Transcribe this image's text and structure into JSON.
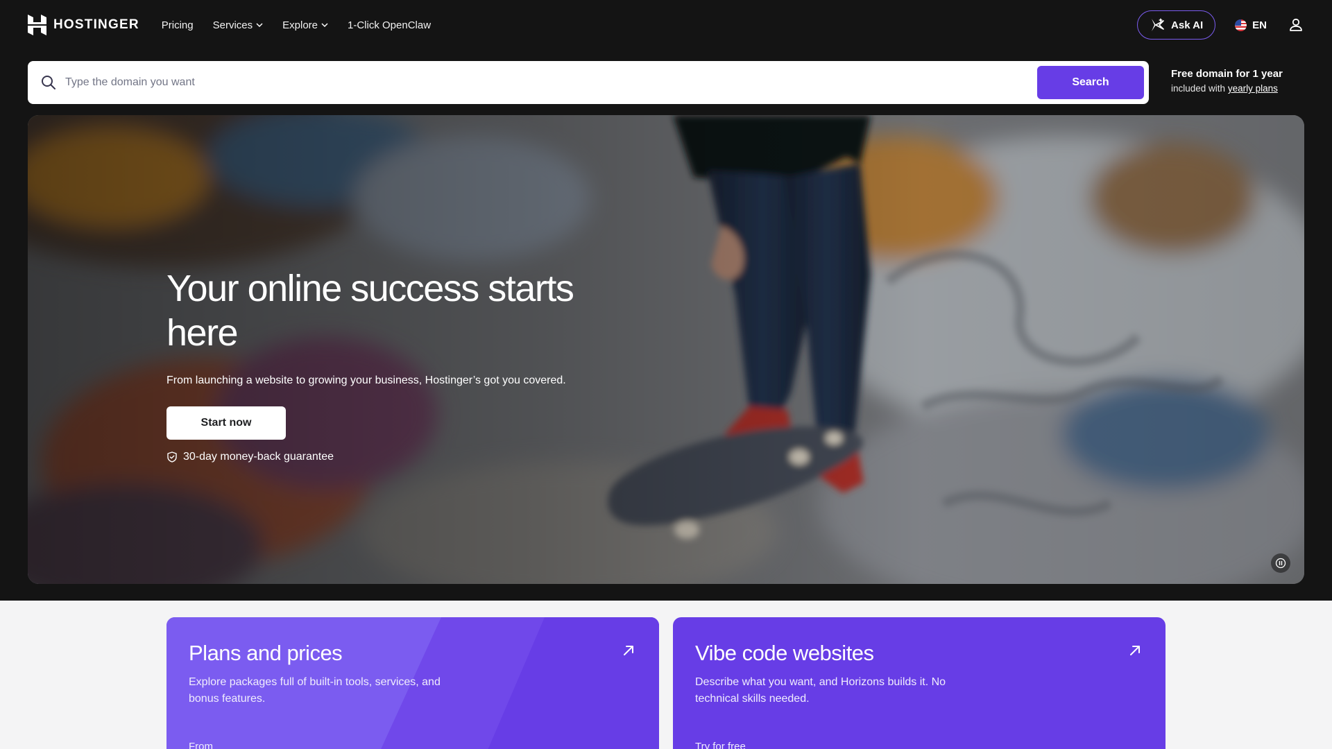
{
  "brand": {
    "name": "HOSTINGER",
    "accent": "#673de6"
  },
  "nav": {
    "items": [
      {
        "label": "Pricing",
        "dropdown": false
      },
      {
        "label": "Services",
        "dropdown": true
      },
      {
        "label": "Explore",
        "dropdown": true
      },
      {
        "label": "1-Click OpenClaw",
        "dropdown": false
      }
    ]
  },
  "header": {
    "ask_ai_label": "Ask AI",
    "language": "EN",
    "icons": [
      "hostinger-logo-icon",
      "ai-sparkle-icon",
      "us-flag-icon",
      "user-icon"
    ]
  },
  "search": {
    "placeholder": "Type the domain you want",
    "value": "",
    "button_label": "Search"
  },
  "promo": {
    "title": "Free domain for 1 year",
    "sub_prefix": "included with",
    "link_label": "yearly plans"
  },
  "hero": {
    "title": "Your online success starts here",
    "subtitle": "From launching a website to growing your business, Hostinger’s got you covered.",
    "cta_label": "Start now",
    "guarantee": "30-day money-back guarantee"
  },
  "cards": [
    {
      "title": "Plans and prices",
      "description": "Explore packages full of built-in tools, services, and bonus features.",
      "extra": "From"
    },
    {
      "title": "Vibe code websites",
      "description": "Describe what you want, and Horizons builds it. No technical skills needed.",
      "extra": "Try for free"
    }
  ]
}
